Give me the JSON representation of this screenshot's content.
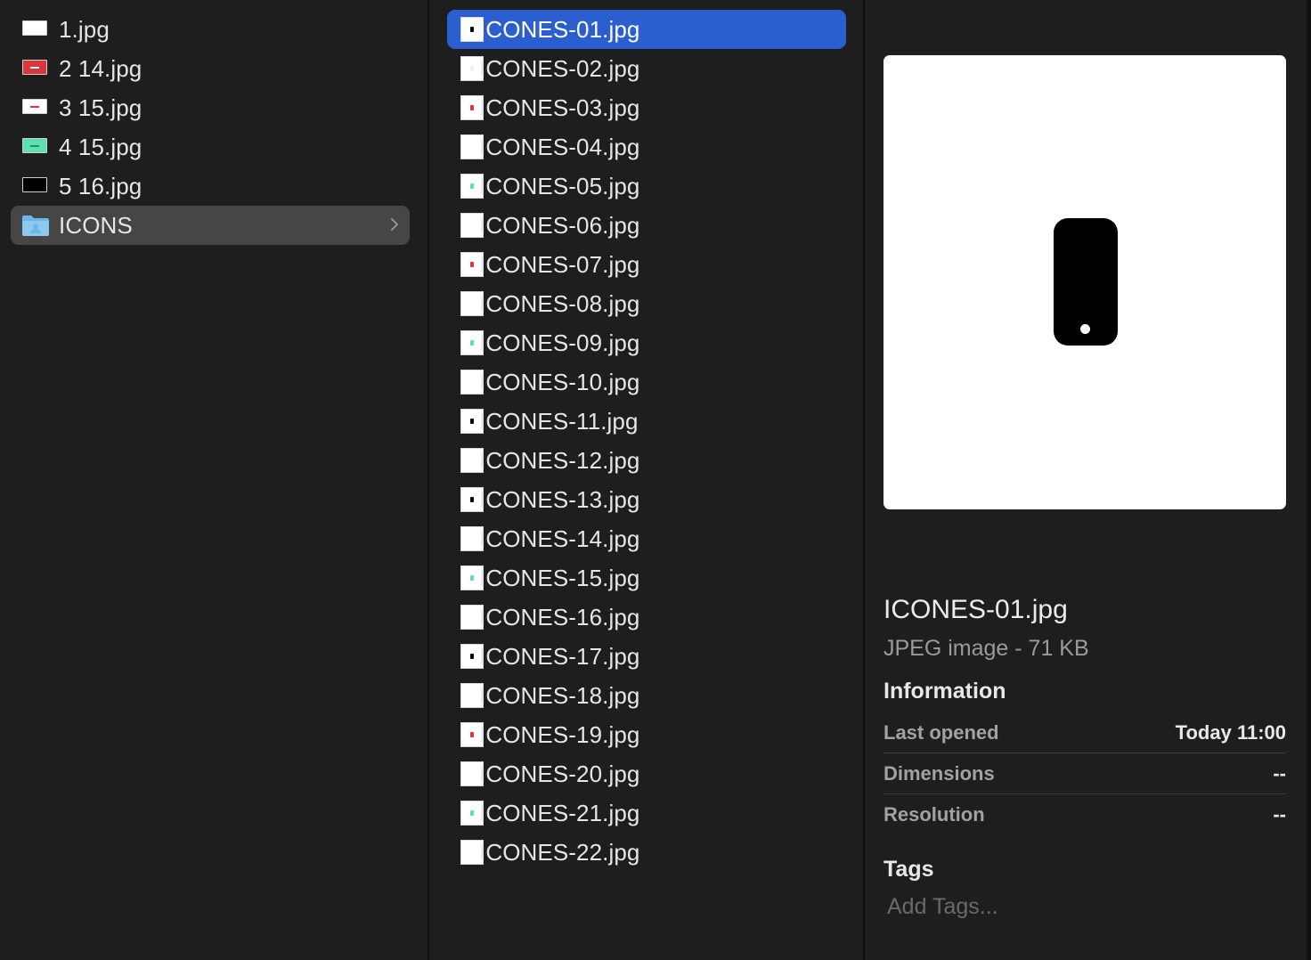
{
  "sidebar_column": {
    "items": [
      {
        "label": "1.jpg",
        "icon": "image-thumbnail-icon",
        "mark_color": "#ffffff",
        "fill": "#ffffff"
      },
      {
        "label": "2 14.jpg",
        "icon": "image-thumbnail-icon",
        "mark_color": "#ffffff",
        "fill": "#d9363e"
      },
      {
        "label": "3 15.jpg",
        "icon": "image-thumbnail-icon",
        "mark_color": "#d9363e",
        "fill": "#ffffff"
      },
      {
        "label": "4 15.jpg",
        "icon": "image-thumbnail-icon",
        "mark_color": "#2a8a60",
        "fill": "#5de0b0"
      },
      {
        "label": "5 16.jpg",
        "icon": "image-thumbnail-icon",
        "mark_color": "#000000",
        "fill": "#000000"
      },
      {
        "label": "ICONS",
        "icon": "folder-icon",
        "selected": true
      }
    ]
  },
  "files_column": {
    "items": [
      {
        "label": "ICONES-01.jpg",
        "dot": "#000000",
        "selected": true
      },
      {
        "label": "ICONES-02.jpg",
        "dot": "#f2f2f2"
      },
      {
        "label": "ICONES-03.jpg",
        "dot": "#d9363e"
      },
      {
        "label": "ICONES-04.jpg",
        "dot": "#ffffff"
      },
      {
        "label": "ICONES-05.jpg",
        "dot": "#5de0b0"
      },
      {
        "label": "ICONES-06.jpg",
        "dot": "#ffffff"
      },
      {
        "label": "ICONES-07.jpg",
        "dot": "#d9363e"
      },
      {
        "label": "ICONES-08.jpg",
        "dot": "#ffffff"
      },
      {
        "label": "ICONES-09.jpg",
        "dot": "#5de0b0"
      },
      {
        "label": "ICONES-10.jpg",
        "dot": "#ffffff"
      },
      {
        "label": "ICONES-11.jpg",
        "dot": "#000000"
      },
      {
        "label": "ICONES-12.jpg",
        "dot": "#ffffff"
      },
      {
        "label": "ICONES-13.jpg",
        "dot": "#000000"
      },
      {
        "label": "ICONES-14.jpg",
        "dot": "#ffffff"
      },
      {
        "label": "ICONES-15.jpg",
        "dot": "#5de0b0"
      },
      {
        "label": "ICONES-16.jpg",
        "dot": "#ffffff"
      },
      {
        "label": "ICONES-17.jpg",
        "dot": "#000000"
      },
      {
        "label": "ICONES-18.jpg",
        "dot": "#ffffff"
      },
      {
        "label": "ICONES-19.jpg",
        "dot": "#d9363e"
      },
      {
        "label": "ICONES-20.jpg",
        "dot": "#ffffff"
      },
      {
        "label": "ICONES-21.jpg",
        "dot": "#5de0b0"
      },
      {
        "label": "ICONES-22.jpg",
        "dot": "#ffffff"
      }
    ]
  },
  "preview": {
    "icon": "smartphone-icon",
    "title": "ICONES-01.jpg",
    "subtitle": "JPEG image - 71 KB",
    "information_heading": "Information",
    "information": [
      {
        "key": "Last opened",
        "value": "Today 11:00"
      },
      {
        "key": "Dimensions",
        "value": "--"
      },
      {
        "key": "Resolution",
        "value": "--"
      }
    ],
    "tags_heading": "Tags",
    "tags_placeholder": "Add Tags..."
  },
  "colors": {
    "background": "#1e1e1e",
    "selection_accent": "#2b5fcf",
    "folder_selection": "#464646",
    "folder_icon": "#6cb6e8"
  }
}
